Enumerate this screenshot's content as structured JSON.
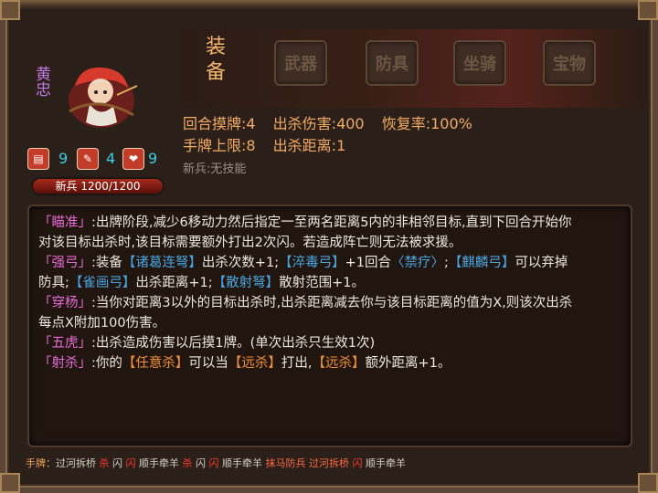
{
  "hero": {
    "name": "黄忠",
    "stats": [
      {
        "icon": "card-icon",
        "value": "9"
      },
      {
        "icon": "sword-icon",
        "value": "4"
      },
      {
        "icon": "heart-icon",
        "value": "9"
      }
    ],
    "hp_text": "新兵 1200/1200"
  },
  "equipment": {
    "title": "装备",
    "slots": [
      "武器",
      "防具",
      "坐骑",
      "宝物"
    ]
  },
  "attributes": {
    "row1": [
      "回合摸牌:4",
      "出杀伤害:400",
      "恢复率:100%"
    ],
    "row2": [
      "手牌上限:8",
      "出杀距离:1"
    ],
    "skill": "新兵:无技能"
  },
  "skills": {
    "l1": {
      "tag": "「瞄准」",
      "text": ":出牌阶段,减少6移动力然后指定一至两名距离5内的非相邻目标,直到下回合开始你"
    },
    "l2": {
      "text": "对该目标出杀时,该目标需要额外打出2次闪。若造成阵亡则无法被求援。"
    },
    "l3": {
      "tag": "「强弓」",
      "t1": ":装备",
      "b1": "【诸葛连弩】",
      "t2": "出杀次数+1;",
      "b2": "【淬毒弓】",
      "t3": "+1回合",
      "b3": "〈禁疗〉",
      "t4": ";",
      "b4": "【麒麟弓】",
      "t5": "可以弃掉"
    },
    "l4": {
      "t1": "防具;",
      "b1": "【雀画弓】",
      "t2": "出杀距离+1;",
      "b2": "【散射弩】",
      "t3": "散射范围+1。"
    },
    "l5": {
      "tag": "「穿杨」",
      "text": ":当你对距离3以外的目标出杀时,出杀距离减去你与该目标距离的值为X,则该次出杀"
    },
    "l6": {
      "text": "每点X附加100伤害。"
    },
    "l7": {
      "tag": "「五虎」",
      "text": ":出杀造成伤害以后摸1牌。(单次出杀只生效1次)"
    },
    "l8": {
      "tag": "「射杀」",
      "t1": ":你的",
      "o1": "【任意杀】",
      "t2": "可以当",
      "o2": "【远杀】",
      "t3": "打出,",
      "o3": "【远杀】",
      "t4": "额外距离+1。"
    }
  },
  "hand": {
    "label": "手牌：",
    "cards": [
      {
        "name": "过河拆桥",
        "color": "g"
      },
      {
        "name": "杀",
        "color": "r"
      },
      {
        "name": "闪",
        "color": "g"
      },
      {
        "name": "闪",
        "color": "r"
      },
      {
        "name": "顺手牵羊",
        "color": "g"
      },
      {
        "name": "杀",
        "color": "r"
      },
      {
        "name": "闪",
        "color": "g"
      },
      {
        "name": "闪",
        "color": "r"
      },
      {
        "name": "顺手牵羊",
        "color": "g"
      },
      {
        "name": "抹马防兵",
        "color": "rb"
      },
      {
        "name": "过河拆桥",
        "color": "rb"
      },
      {
        "name": "闪",
        "color": "r"
      },
      {
        "name": "顺手牵羊",
        "color": "g"
      }
    ]
  }
}
